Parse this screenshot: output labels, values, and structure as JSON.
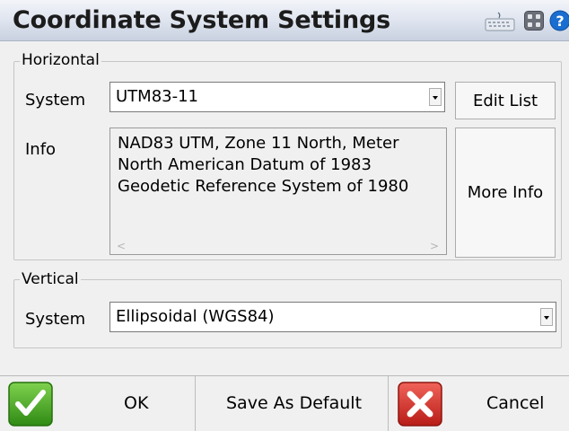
{
  "header": {
    "title": "Coordinate System Settings",
    "icons": [
      "keyboard-icon",
      "menu-grid-icon",
      "help-icon"
    ]
  },
  "horizontal": {
    "legend": "Horizontal",
    "system_label": "System",
    "system_value": "UTM83-11",
    "info_label": "Info",
    "info_lines": [
      "NAD83 UTM, Zone 11 North, Meter",
      "North American Datum of 1983",
      "Geodetic Reference System of 1980"
    ],
    "scroll_left": "<",
    "scroll_right": ">",
    "edit_list_label": "Edit List",
    "more_info_label": "More Info"
  },
  "vertical": {
    "legend": "Vertical",
    "system_label": "System",
    "system_value": "Ellipsoidal (WGS84)"
  },
  "footer": {
    "ok_label": "OK",
    "save_default_label": "Save As Default",
    "cancel_label": "Cancel"
  },
  "colors": {
    "ok_green": "#3a9b1e",
    "cancel_red": "#d52a24",
    "help_blue": "#1a6ed1"
  }
}
